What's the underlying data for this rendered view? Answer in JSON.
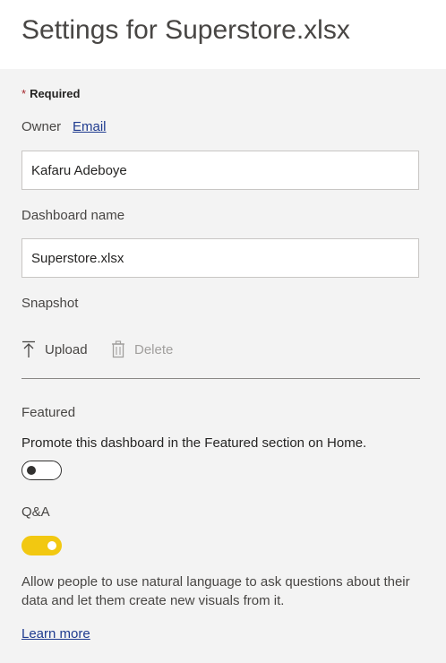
{
  "header": {
    "title": "Settings for Superstore.xlsx"
  },
  "form": {
    "required_marker": "*",
    "required_label": "Required",
    "owner_label": "Owner",
    "email_link": "Email",
    "owner_value": "Kafaru Adeboye",
    "dashboard_name_label": "Dashboard name",
    "dashboard_name_value": "Superstore.xlsx",
    "snapshot_label": "Snapshot",
    "upload_label": "Upload",
    "upload_icon": "upload-arrow-icon",
    "delete_label": "Delete",
    "delete_icon": "trash-icon",
    "featured_label": "Featured",
    "featured_text": "Promote this dashboard in the Featured section on Home.",
    "featured_on": false,
    "qa_label": "Q&A",
    "qa_on": true,
    "qa_description": "Allow people to use natural language to ask questions about their data and let them create new visuals from it.",
    "learn_more": "Learn more"
  },
  "colors": {
    "background": "#f3f3f3",
    "header_background": "#ffffff",
    "link": "#1f3b8f",
    "toggle_on": "#f2c811",
    "required_star": "#a4262c",
    "disabled_text": "#a19f9d"
  }
}
